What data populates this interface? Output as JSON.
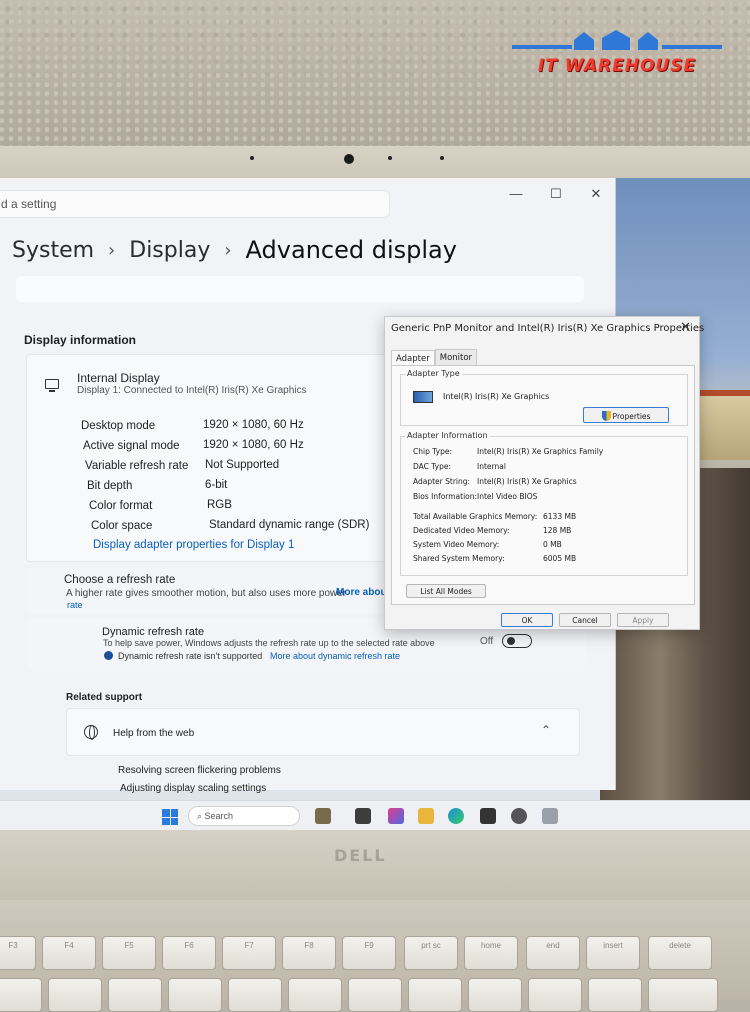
{
  "watermark": {
    "text": "IT WAREHOUSE"
  },
  "laptop": {
    "brand": "DELL"
  },
  "settings": {
    "search_placeholder": "d a setting",
    "breadcrumb": [
      "System",
      "Display",
      "Advanced display"
    ],
    "display_info_title": "Display information",
    "display": {
      "name": "Internal Display",
      "subtitle": "Display 1: Connected to Intel(R) Iris(R) Xe Graphics"
    },
    "specs": [
      {
        "label": "Desktop mode",
        "value": "1920 × 1080, 60 Hz"
      },
      {
        "label": "Active signal mode",
        "value": "1920 × 1080, 60 Hz"
      },
      {
        "label": "Variable refresh rate",
        "value": "Not Supported"
      },
      {
        "label": "Bit depth",
        "value": "6-bit"
      },
      {
        "label": "Color format",
        "value": "RGB"
      },
      {
        "label": "Color space",
        "value": "Standard dynamic range (SDR)"
      }
    ],
    "adapter_link": "Display adapter properties for Display 1",
    "refresh": {
      "title": "Choose a refresh rate",
      "desc": "A higher rate gives smoother motion, but also uses more power",
      "more": "More abou",
      "more2": "rate"
    },
    "dynamic": {
      "title": "Dynamic refresh rate",
      "desc": "To help save power, Windows adjusts the refresh rate up to the selected rate above",
      "note": "Dynamic refresh rate isn't supported",
      "more": "More about dynamic refresh rate",
      "toggle_label": "Off"
    },
    "related_title": "Related support",
    "help_title": "Help from the web",
    "help_links": [
      "Resolving screen flickering problems",
      "Adjusting display scaling settings"
    ]
  },
  "dialog": {
    "title": "Generic PnP Monitor and Intel(R) Iris(R) Xe Graphics Properties",
    "tabs": [
      "Adapter",
      "Monitor"
    ],
    "adapter_type_label": "Adapter Type",
    "adapter_name": "Intel(R) Iris(R) Xe Graphics",
    "properties_button": "Properties",
    "adapter_info_label": "Adapter Information",
    "info": [
      {
        "k": "Chip Type:",
        "v": "Intel(R) Iris(R) Xe Graphics Family"
      },
      {
        "k": "DAC Type:",
        "v": "Internal"
      },
      {
        "k": "Adapter String:",
        "v": "Intel(R) Iris(R) Xe Graphics"
      },
      {
        "k": "Bios Information:",
        "v": "Intel Video BIOS"
      }
    ],
    "memory": [
      {
        "k": "Total Available Graphics Memory:",
        "v": "6133 MB"
      },
      {
        "k": "Dedicated Video Memory:",
        "v": "128 MB"
      },
      {
        "k": "System Video Memory:",
        "v": "0 MB"
      },
      {
        "k": "Shared System Memory:",
        "v": "6005 MB"
      }
    ],
    "list_modes_button": "List All Modes",
    "ok": "OK",
    "cancel": "Cancel",
    "apply": "Apply"
  },
  "taskbar": {
    "search": "Search"
  },
  "keys": [
    "F3",
    "F4",
    "F5",
    "F6",
    "F7",
    "F8",
    "F9",
    "prt sc",
    "home",
    "end",
    "insert",
    "delete"
  ]
}
